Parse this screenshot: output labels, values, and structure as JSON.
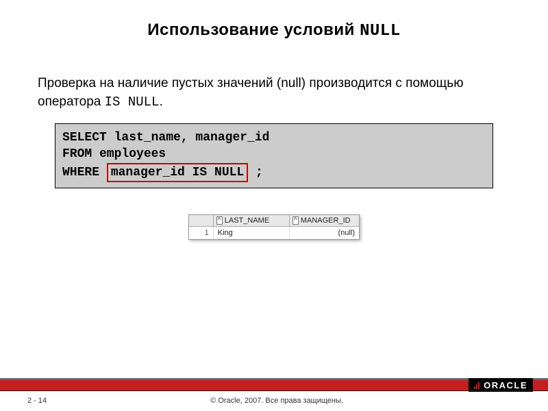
{
  "title_prefix": "Использование условий ",
  "title_mono": "NULL",
  "body_prefix": "Проверка на наличие пустых значений (null) производится с помощью оператора ",
  "body_mono": "IS NULL",
  "body_suffix": ".",
  "code": {
    "line1": "SELECT last_name, manager_id",
    "line2": "FROM   employees",
    "line3_prefix": "WHERE  ",
    "line3_highlight": "manager_id IS NULL",
    "line3_suffix": " ;"
  },
  "table": {
    "headers": {
      "rownum": "",
      "col1": "LAST_NAME",
      "col2": "MANAGER_ID"
    },
    "row": {
      "num": "1",
      "last_name": "King",
      "manager_id": "(null)"
    }
  },
  "footer": {
    "logo": "ORACLE",
    "page": "2 - 14",
    "copyright": "© Oracle, 2007. Все права защищены."
  }
}
